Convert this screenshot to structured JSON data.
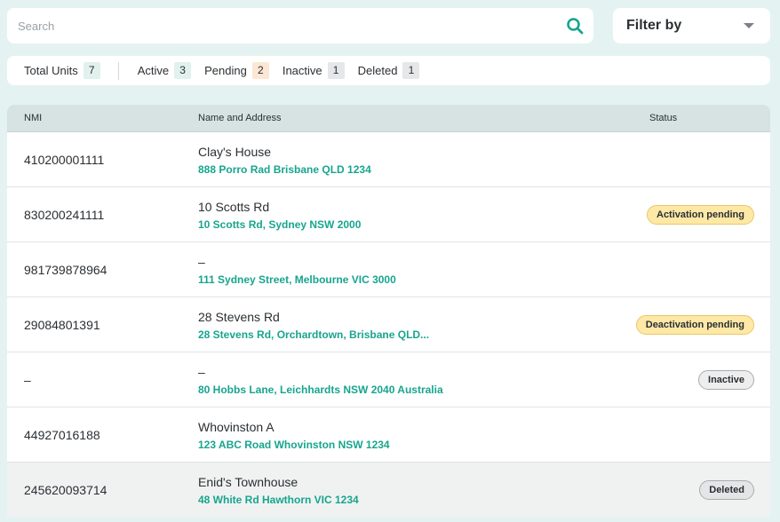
{
  "search": {
    "placeholder": "Search"
  },
  "filter": {
    "label": "Filter by"
  },
  "counts": {
    "total": {
      "label": "Total Units",
      "value": "7"
    },
    "active": {
      "label": "Active",
      "value": "3"
    },
    "pending": {
      "label": "Pending",
      "value": "2"
    },
    "inactive": {
      "label": "Inactive",
      "value": "1"
    },
    "deleted": {
      "label": "Deleted",
      "value": "1"
    }
  },
  "table": {
    "headers": {
      "nmi": "NMI",
      "name": "Name and Address",
      "status": "Status"
    },
    "rows": [
      {
        "nmi": "410200001111",
        "name": "Clay's House",
        "address": "888 Porro Rad Brisbane QLD 1234",
        "status": ""
      },
      {
        "nmi": "830200241111",
        "name": "10 Scotts Rd",
        "address": "10 Scotts Rd, Sydney NSW 2000",
        "status": "Activation pending"
      },
      {
        "nmi": "981739878964",
        "name": "–",
        "address": "111 Sydney Street, Melbourne VIC 3000",
        "status": ""
      },
      {
        "nmi": "29084801391",
        "name": "28 Stevens Rd",
        "address": "28 Stevens Rd, Orchardtown, Brisbane QLD...",
        "status": "Deactivation pending"
      },
      {
        "nmi": "–",
        "name": "–",
        "address": "80 Hobbs Lane, Leichhardts NSW 2040 Australia",
        "status": "Inactive"
      },
      {
        "nmi": "44927016188",
        "name": "Whovinston A",
        "address": "123 ABC Road Whovinston NSW 1234",
        "status": ""
      },
      {
        "nmi": "245620093714",
        "name": "Enid's Townhouse",
        "address": "48 White Rd Hawthorn VIC 1234",
        "status": "Deleted"
      }
    ]
  },
  "colors": {
    "accent": "#17a58e",
    "background": "#e4f3f1",
    "pending": "#fde8a6"
  }
}
